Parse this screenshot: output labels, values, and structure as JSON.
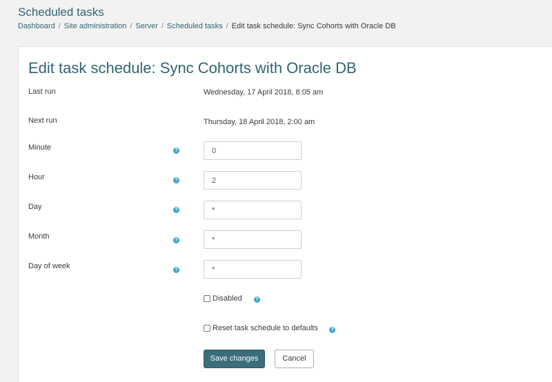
{
  "header": {
    "title": "Scheduled tasks",
    "breadcrumb": [
      "Dashboard",
      "Site administration",
      "Server",
      "Scheduled tasks",
      "Edit task schedule: Sync Cohorts with Oracle DB"
    ],
    "separator": "/"
  },
  "form": {
    "heading": "Edit task schedule: Sync Cohorts with Oracle DB",
    "last_run_label": "Last run",
    "last_run_value": "Wednesday, 17 April 2018, 8:05 am",
    "next_run_label": "Next run",
    "next_run_value": "Thursday, 18 April 2018, 2:00 am",
    "minute_label": "Minute",
    "minute_value": "0",
    "hour_label": "Hour",
    "hour_value": "2",
    "day_label": "Day",
    "day_value": "*",
    "month_label": "Month",
    "month_value": "*",
    "dow_label": "Day of week",
    "dow_value": "*",
    "disabled_label": "Disabled",
    "reset_label": "Reset task schedule to defaults",
    "help_glyph": "?",
    "save_label": "Save changes",
    "cancel_label": "Cancel"
  },
  "colors": {
    "accent": "#2f6473",
    "primary_button": "#3b6d7c",
    "help_icon": "#3aa6c9"
  },
  "icons": [
    "question-circle-icon"
  ]
}
